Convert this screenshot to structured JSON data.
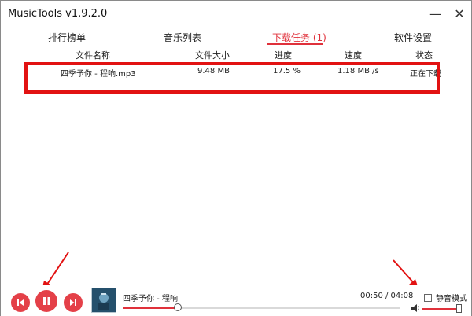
{
  "window": {
    "title": "MusicTools v1.9.2.0",
    "minimize_icon": "minimize-icon",
    "close_icon": "close-icon"
  },
  "tabs": [
    {
      "label": "排行榜单",
      "active": false
    },
    {
      "label": "音乐列表",
      "active": false
    },
    {
      "label": "下载任务 (1)",
      "active": true
    },
    {
      "label": "软件设置",
      "active": false
    }
  ],
  "downloads": {
    "columns": [
      "文件名称",
      "文件大小",
      "进度",
      "速度",
      "状态"
    ],
    "rows": [
      {
        "name": "四季予你 - 程响.mp3",
        "size": "9.48 MB",
        "progress": "17.5 %",
        "speed": "1.18 MB /s",
        "status": "正在下载"
      }
    ]
  },
  "player": {
    "song": "四季予你 - 程响",
    "time": "00:50 / 04:08",
    "progress_fraction": 0.2,
    "mute_label": "静音模式",
    "mute_checked": false,
    "volume_fraction": 1.0,
    "icons": {
      "prev": "skip-previous-icon",
      "play": "pause-icon",
      "next": "skip-next-icon",
      "volume": "speaker-icon"
    }
  },
  "colors": {
    "accent": "#e0313b",
    "annotation": "#e21212"
  }
}
